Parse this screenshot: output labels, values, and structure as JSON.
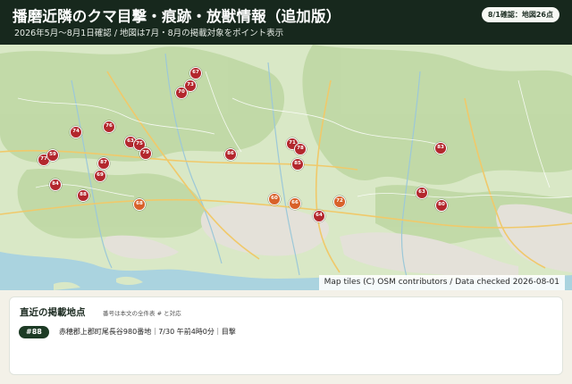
{
  "header": {
    "title": "播磨近隣のクマ目撃・痕跡・放獣情報（追加版）",
    "subtitle": "2026年5月〜8月1日確認 / 地図は7月・8月の掲載対象をポイント表示",
    "badge": "8/1確認：地図26点"
  },
  "map": {
    "attribution": "Map tiles (C) OSM contributors / Data checked 2026-08-01",
    "colors": {
      "land": "#d9e8c6",
      "forest": "#bfd8a4",
      "urban": "#e4e1d9",
      "sea": "#aad3df",
      "road": "#f0c96a",
      "marker": "#b3272d",
      "marker_recent": "#d8612a"
    },
    "markers": [
      {
        "label": "67",
        "recent": false
      },
      {
        "label": "73",
        "recent": false
      },
      {
        "label": "70",
        "recent": false
      },
      {
        "label": "74",
        "recent": false
      },
      {
        "label": "76",
        "recent": false
      },
      {
        "label": "63",
        "recent": false
      },
      {
        "label": "75",
        "recent": false
      },
      {
        "label": "79",
        "recent": false
      },
      {
        "label": "71",
        "recent": false
      },
      {
        "label": "78",
        "recent": false
      },
      {
        "label": "77",
        "recent": false
      },
      {
        "label": "59",
        "recent": false
      },
      {
        "label": "87",
        "recent": false
      },
      {
        "label": "69",
        "recent": false
      },
      {
        "label": "86",
        "recent": false
      },
      {
        "label": "85",
        "recent": false
      },
      {
        "label": "83",
        "recent": false
      },
      {
        "label": "84",
        "recent": false
      },
      {
        "label": "88",
        "recent": false
      },
      {
        "label": "68",
        "recent": true
      },
      {
        "label": "60",
        "recent": true
      },
      {
        "label": "66",
        "recent": true
      },
      {
        "label": "72",
        "recent": true
      },
      {
        "label": "64",
        "recent": false
      },
      {
        "label": "63",
        "recent": false
      },
      {
        "label": "80",
        "recent": false
      }
    ]
  },
  "panel": {
    "title": "直近の掲載地点",
    "note": "番号は本文の全件表 # と対応",
    "entry": {
      "id": "#88",
      "text": "赤穂郡上郡町尾長谷980番地｜7/30 午前4時0分｜目撃"
    }
  }
}
